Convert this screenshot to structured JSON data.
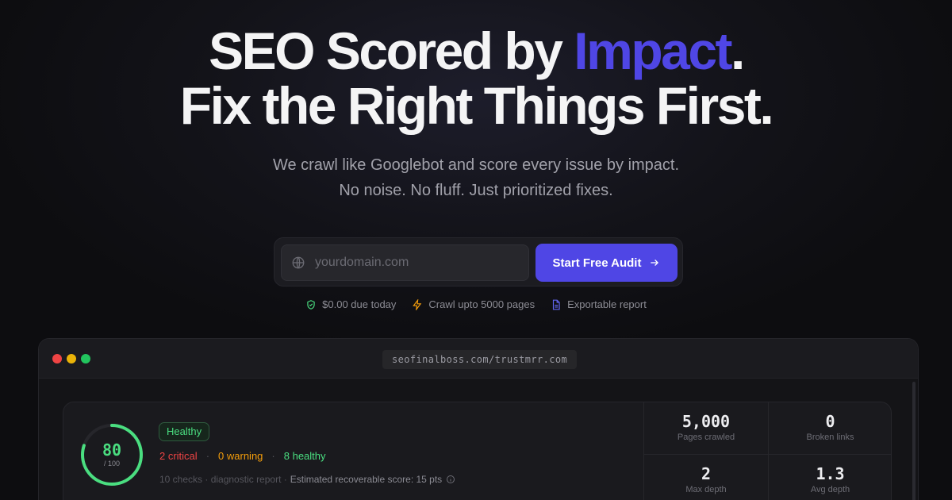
{
  "hero": {
    "headline_part1": "SEO Scored by ",
    "headline_accent": "Impact",
    "headline_part2": ".",
    "headline_line2": "Fix the Right Things First.",
    "subline1": "We crawl like Googlebot and score every issue by impact.",
    "subline2": "No noise. No fluff. Just prioritized fixes."
  },
  "form": {
    "input_placeholder": "yourdomain.com",
    "input_icon": "globe-icon",
    "cta_label": "Start Free Audit",
    "cta_icon": "arrow-right-icon"
  },
  "perks": [
    {
      "icon": "shield-check-icon",
      "label": "$0.00 due today",
      "color": "#4ade80"
    },
    {
      "icon": "lightning-icon",
      "label": "Crawl upto 5000 pages",
      "color": "#f59e0b"
    },
    {
      "icon": "document-icon",
      "label": "Exportable report",
      "color": "#6366f1"
    }
  ],
  "browser": {
    "url": "seofinalboss.com/trustmrr.com",
    "traffic_lights": [
      "#ef4444",
      "#eab308",
      "#22c55e"
    ]
  },
  "report": {
    "score": "80",
    "score_max": "/ 100",
    "score_fraction": 0.8,
    "status_badge": "Healthy",
    "critical": "2 critical",
    "warning": "0 warning",
    "healthy": "8 healthy",
    "meta_checks": "10 checks · diagnostic report ·",
    "meta_estimate": "Estimated recoverable score: 15 pts",
    "metrics": [
      {
        "value": "5,000",
        "label": "Pages crawled"
      },
      {
        "value": "0",
        "label": "Broken links"
      },
      {
        "value": "2",
        "label": "Max depth"
      },
      {
        "value": "1.3",
        "label": "Avg depth"
      }
    ]
  },
  "colors": {
    "accent": "#4f46e5",
    "background": "#0d0d10",
    "healthy": "#4ade80",
    "critical": "#ef4444",
    "warning": "#f59e0b"
  }
}
